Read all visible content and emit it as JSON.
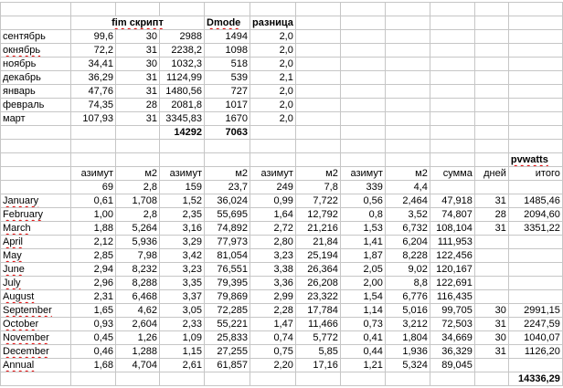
{
  "top_table": {
    "header": {
      "fim": "fim скрипт",
      "dmode": "Dmode",
      "diff": "разница"
    },
    "rows": [
      [
        "сентябрь",
        "99,6",
        "30",
        "2988",
        "1494",
        "2,0"
      ],
      [
        "окнябрь",
        "72,2",
        "31",
        "2238,2",
        "1098",
        "2,0"
      ],
      [
        "ноябрь",
        "34,41",
        "30",
        "1032,3",
        "518",
        "2,0"
      ],
      [
        "декабрь",
        "36,29",
        "31",
        "1124,99",
        "539",
        "2,1"
      ],
      [
        "январь",
        "47,76",
        "31",
        "1480,56",
        "727",
        "2,0"
      ],
      [
        "февраль",
        "74,35",
        "28",
        "2081,8",
        "1017",
        "2,0"
      ],
      [
        "март",
        "107,93",
        "31",
        "3345,83",
        "1670",
        "2,0"
      ]
    ],
    "totals": {
      "fim": "14292",
      "dmode": "7063"
    }
  },
  "bottom_table": {
    "title": "pvwatts",
    "headers": [
      "азимут",
      "м2",
      "азимут",
      "м2",
      "азимут",
      "м2",
      "азимут",
      "м2",
      "сумма",
      "дней",
      "итого"
    ],
    "params": [
      "69",
      "2,8",
      "159",
      "23,7",
      "249",
      "7,8",
      "339",
      "4,4"
    ],
    "rows": [
      [
        "January",
        "0,61",
        "1,708",
        "1,52",
        "36,024",
        "0,99",
        "7,722",
        "0,56",
        "2,464",
        "47,918",
        "31",
        "1485,46"
      ],
      [
        "February",
        "1,00",
        "2,8",
        "2,35",
        "55,695",
        "1,64",
        "12,792",
        "0,8",
        "3,52",
        "74,807",
        "28",
        "2094,60"
      ],
      [
        "March",
        "1,88",
        "5,264",
        "3,16",
        "74,892",
        "2,72",
        "21,216",
        "1,53",
        "6,732",
        "108,104",
        "31",
        "3351,22"
      ],
      [
        "April",
        "2,12",
        "5,936",
        "3,29",
        "77,973",
        "2,80",
        "21,84",
        "1,41",
        "6,204",
        "111,953",
        "",
        ""
      ],
      [
        "May",
        "2,85",
        "7,98",
        "3,42",
        "81,054",
        "3,23",
        "25,194",
        "1,87",
        "8,228",
        "122,456",
        "",
        ""
      ],
      [
        "June",
        "2,94",
        "8,232",
        "3,23",
        "76,551",
        "3,38",
        "26,364",
        "2,05",
        "9,02",
        "120,167",
        "",
        ""
      ],
      [
        "July",
        "2,96",
        "8,288",
        "3,35",
        "79,395",
        "3,36",
        "26,208",
        "2,00",
        "8,8",
        "122,691",
        "",
        ""
      ],
      [
        "August",
        "2,31",
        "6,468",
        "3,37",
        "79,869",
        "2,99",
        "23,322",
        "1,54",
        "6,776",
        "116,435",
        "",
        ""
      ],
      [
        "September",
        "1,65",
        "4,62",
        "3,05",
        "72,285",
        "2,28",
        "17,784",
        "1,14",
        "5,016",
        "99,705",
        "30",
        "2991,15"
      ],
      [
        "October",
        "0,93",
        "2,604",
        "2,33",
        "55,221",
        "1,47",
        "11,466",
        "0,73",
        "3,212",
        "72,503",
        "31",
        "2247,59"
      ],
      [
        "November",
        "0,45",
        "1,26",
        "1,09",
        "25,833",
        "0,74",
        "5,772",
        "0,41",
        "1,804",
        "34,669",
        "30",
        "1040,07"
      ],
      [
        "December",
        "0,46",
        "1,288",
        "1,15",
        "27,255",
        "0,75",
        "5,85",
        "0,44",
        "1,936",
        "36,329",
        "31",
        "1126,20"
      ],
      [
        "Annual",
        "1,68",
        "4,704",
        "2,61",
        "61,857",
        "2,20",
        "17,16",
        "1,21",
        "5,324",
        "89,045",
        "",
        ""
      ]
    ],
    "total": "14336,29"
  }
}
